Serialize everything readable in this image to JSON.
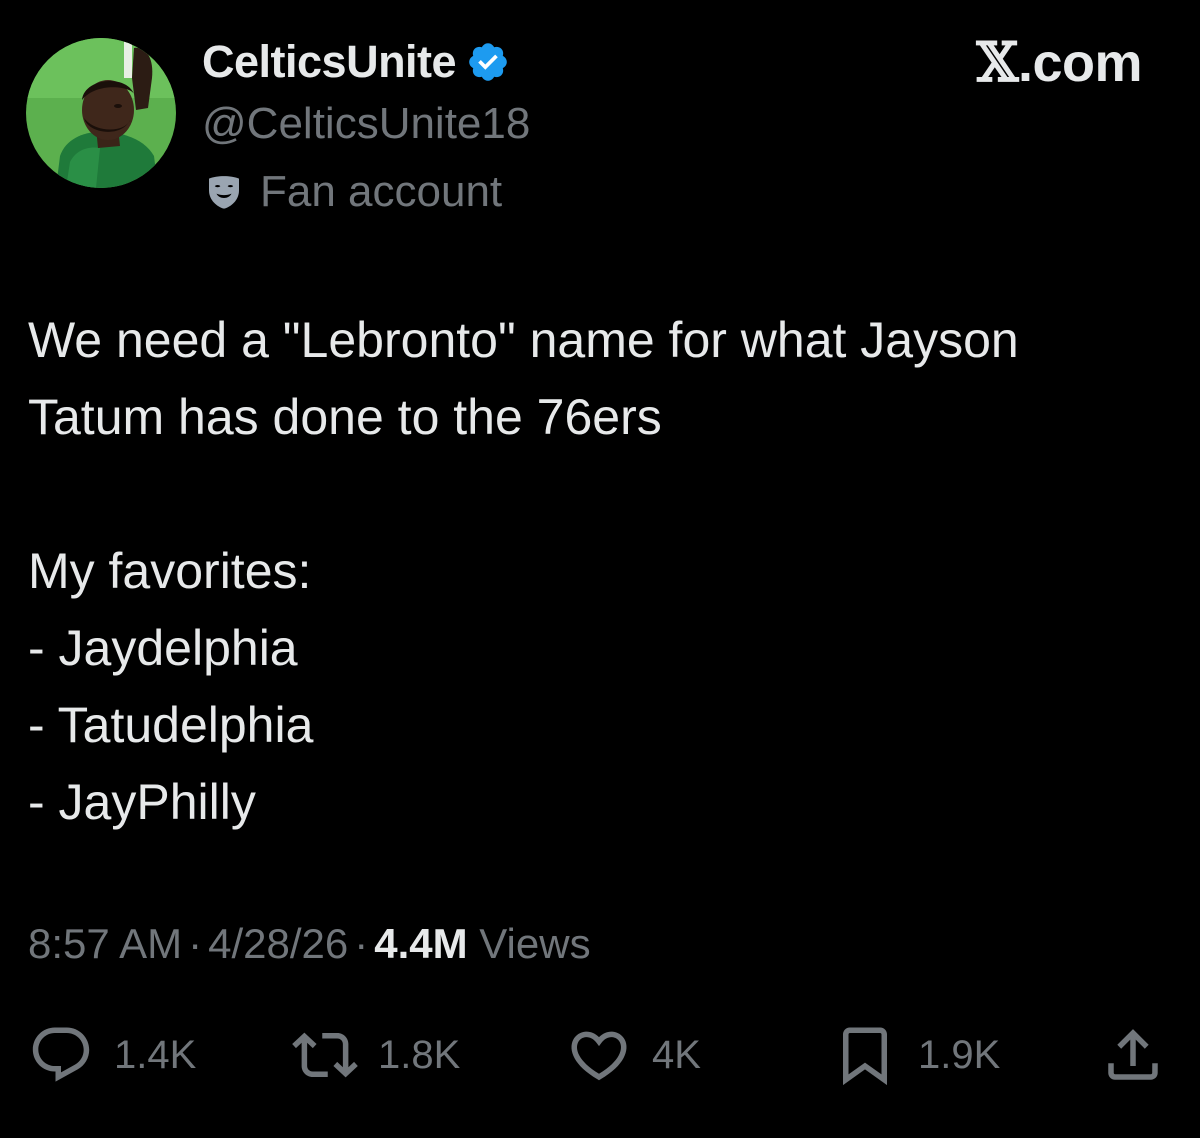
{
  "author": {
    "display_name": "CelticsUnite",
    "handle": "@CelticsUnite18",
    "badge_label": "Fan account",
    "verified": true,
    "avatar_icon": "player-avatar",
    "verified_color": "#1d9bf0"
  },
  "site": {
    "glyph": "𝕏",
    "suffix": ".com"
  },
  "tweet": {
    "lines": [
      "We need a \"Lebronto\" name for what Jayson",
      "Tatum has done to the 76ers",
      "",
      "My favorites:",
      "- Jaydelphia",
      "- Tatudelphia",
      "- JayPhilly"
    ]
  },
  "meta": {
    "time": "8:57 AM",
    "date": "4/28/26",
    "views_count": "4.4M",
    "views_label": "Views",
    "separator": "·"
  },
  "actions": {
    "reply": {
      "icon": "reply-icon",
      "count": "1.4K"
    },
    "repost": {
      "icon": "repost-icon",
      "count": "1.8K"
    },
    "like": {
      "icon": "heart-icon",
      "count": "4K"
    },
    "bookmark": {
      "icon": "bookmark-icon",
      "count": "1.9K"
    },
    "share": {
      "icon": "share-icon"
    }
  },
  "colors": {
    "background": "#000000",
    "primary_text": "#e7e9ea",
    "secondary_text": "#71767b",
    "avatar_bg": "#5cb04e"
  }
}
